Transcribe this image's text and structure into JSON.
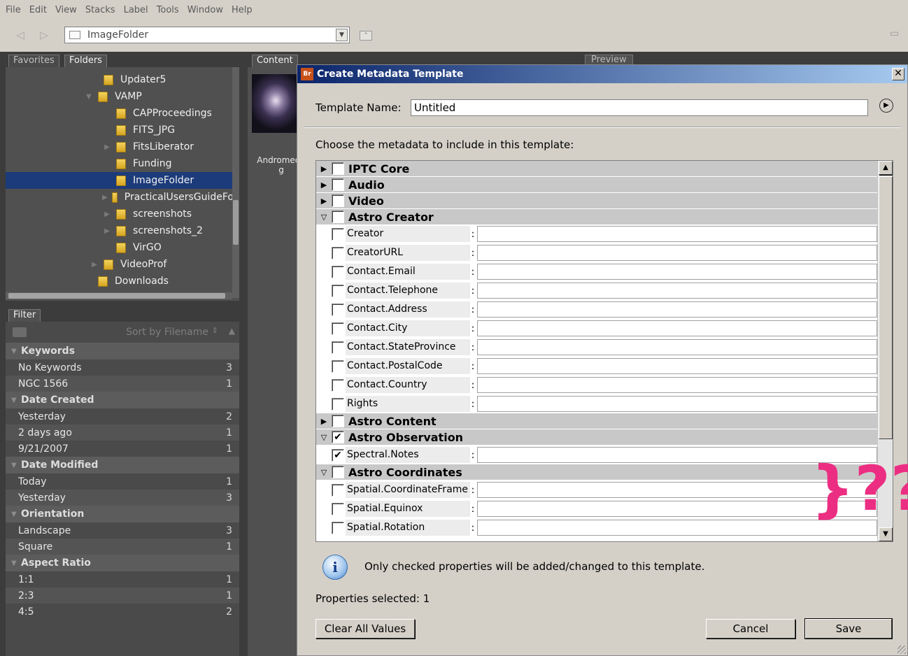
{
  "menu": [
    "File",
    "Edit",
    "View",
    "Stacks",
    "Label",
    "Tools",
    "Window",
    "Help"
  ],
  "pathbar": {
    "back_icon": "back-arrow-icon",
    "forward_icon": "forward-arrow-icon",
    "path": "ImageFolder"
  },
  "left_tabs": [
    "Favorites",
    "Folders"
  ],
  "folders": [
    {
      "label": "Updater5",
      "expander": "",
      "level": 2
    },
    {
      "label": "VAMP",
      "expander": "▼",
      "level": 1
    },
    {
      "label": "CAPProceedings",
      "expander": "",
      "level": 3
    },
    {
      "label": "FITS_JPG",
      "expander": "",
      "level": 3
    },
    {
      "label": "FitsLiberator",
      "expander": "▶",
      "level": 3
    },
    {
      "label": "Funding",
      "expander": "",
      "level": 3
    },
    {
      "label": "ImageFolder",
      "expander": "",
      "level": 3,
      "selected": true
    },
    {
      "label": "PracticalUsersGuideFo",
      "expander": "▶",
      "level": 3
    },
    {
      "label": "screenshots",
      "expander": "▶",
      "level": 3
    },
    {
      "label": "screenshots_2",
      "expander": "▶",
      "level": 3
    },
    {
      "label": "VirGO",
      "expander": "",
      "level": 3
    },
    {
      "label": "VideoProf",
      "expander": "▶",
      "level": 2
    },
    {
      "label": "Downloads",
      "expander": "",
      "level": 1
    }
  ],
  "filter": {
    "tab": "Filter",
    "sort_label": "Sort by Filename",
    "groups": [
      {
        "title": "Keywords",
        "items": [
          {
            "label": "No Keywords",
            "count": "3"
          },
          {
            "label": "NGC 1566",
            "count": "1"
          }
        ]
      },
      {
        "title": "Date Created",
        "items": [
          {
            "label": "Yesterday",
            "count": "2"
          },
          {
            "label": "2 days ago",
            "count": "1"
          },
          {
            "label": "9/21/2007",
            "count": "1"
          }
        ]
      },
      {
        "title": "Date Modified",
        "items": [
          {
            "label": "Today",
            "count": "1"
          },
          {
            "label": "Yesterday",
            "count": "3"
          }
        ]
      },
      {
        "title": "Orientation",
        "items": [
          {
            "label": "Landscape",
            "count": "3"
          },
          {
            "label": "Square",
            "count": "1"
          }
        ]
      },
      {
        "title": "Aspect Ratio",
        "items": [
          {
            "label": "1:1",
            "count": "1"
          },
          {
            "label": "2:3",
            "count": "1"
          },
          {
            "label": "4:5",
            "count": "2"
          }
        ]
      }
    ]
  },
  "content": {
    "tab": "Content",
    "thumb_caption_1": "Andromeda",
    "thumb_caption_2": "g"
  },
  "preview_tab": "Preview",
  "dialog": {
    "app_badge": "Br",
    "title": "Create Metadata Template",
    "close": "✕",
    "template_name_label": "Template Name:",
    "template_name_value": "Untitled",
    "choose_label": "Choose the metadata to include in this template:",
    "groups_top": [
      {
        "name": "IPTC Core",
        "expander": "▶",
        "checked": ""
      },
      {
        "name": "Audio",
        "expander": "▶",
        "checked": ""
      },
      {
        "name": "Video",
        "expander": "▶",
        "checked": ""
      },
      {
        "name": "Astro Creator",
        "expander": "▽",
        "checked": ""
      }
    ],
    "creator_props": [
      "Creator",
      "CreatorURL",
      "Contact.Email",
      "Contact.Telephone",
      "Contact.Address",
      "Contact.City",
      "Contact.StateProvince",
      "Contact.PostalCode",
      "Contact.Country",
      "Rights"
    ],
    "astro_content": {
      "name": "Astro Content",
      "expander": "▶",
      "checked": ""
    },
    "astro_observation": {
      "name": "Astro Observation",
      "expander": "▽",
      "checked": "✔"
    },
    "observation_props": [
      {
        "label": "Spectral.Notes",
        "checked": "✔"
      }
    ],
    "astro_coordinates": {
      "name": "Astro Coordinates",
      "expander": "▽",
      "checked": ""
    },
    "coordinate_props": [
      "Spatial.CoordinateFrame",
      "Spatial.Equinox",
      "Spatial.Rotation"
    ],
    "annotation": "}??",
    "info_text": "Only checked properties will be added/changed to this template.",
    "properties_selected_label": "Properties selected:",
    "properties_selected_value": "1",
    "clear_button": "Clear All Values",
    "cancel_button": "Cancel",
    "save_button": "Save"
  }
}
